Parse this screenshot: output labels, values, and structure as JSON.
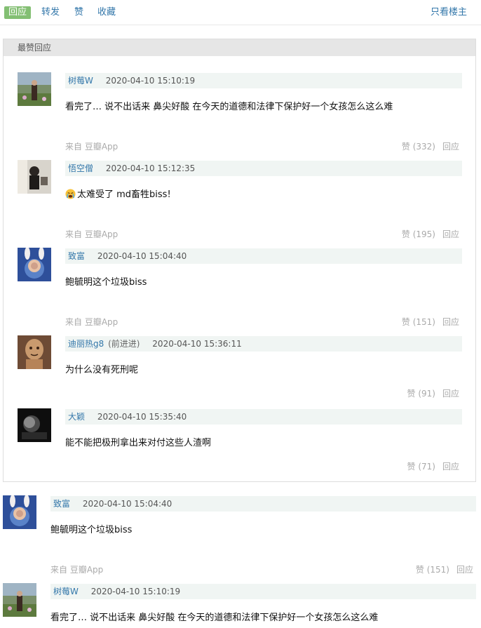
{
  "toolbar": {
    "tabs": [
      {
        "label": "回应",
        "active": true
      },
      {
        "label": "转发",
        "active": false
      },
      {
        "label": "赞",
        "active": false
      },
      {
        "label": "收藏",
        "active": false
      }
    ],
    "right_link": "只看楼主"
  },
  "best": {
    "header": "最赞回应",
    "comments": [
      {
        "user": "树莓W",
        "tag": "",
        "time": "2020-04-10 15:10:19",
        "content": "看完了… 说不出话来 鼻尖好酸 在今天的道德和法律下保护好一个女孩怎么这么难",
        "source": "来自 豆瓣App",
        "likes": "赞 (332)",
        "reply": "回应"
      },
      {
        "user": "悟空僧",
        "tag": "",
        "time": "2020-04-10 15:12:35",
        "content": "太难受了 md畜牲biss!",
        "emoji": "crying-face-icon",
        "source": "来自 豆瓣App",
        "likes": "赞 (195)",
        "reply": "回应"
      },
      {
        "user": "致富",
        "tag": "",
        "time": "2020-04-10 15:04:40",
        "content": "鲍毓明这个垃圾biss",
        "source": "来自 豆瓣App",
        "likes": "赞 (151)",
        "reply": "回应"
      },
      {
        "user": "迪丽热g8",
        "tag": "(前进进)",
        "time": "2020-04-10 15:36:11",
        "content": "为什么没有死刑呢",
        "source": "",
        "likes": "赞 (91)",
        "reply": "回应"
      },
      {
        "user": "大颖",
        "tag": "",
        "time": "2020-04-10 15:35:40",
        "content": "能不能把极刑拿出来对付这些人渣啊",
        "source": "",
        "likes": "赞 (71)",
        "reply": "回应"
      }
    ]
  },
  "all": {
    "comments": [
      {
        "user": "致富",
        "tag": "",
        "time": "2020-04-10 15:04:40",
        "content": "鲍毓明这个垃圾biss",
        "source": "来自 豆瓣App",
        "likes": "赞 (151)",
        "reply": "回应"
      },
      {
        "user": "树莓W",
        "tag": "",
        "time": "2020-04-10 15:10:19",
        "content": "看完了… 说不出话来 鼻尖好酸 在今天的道德和法律下保护好一个女孩怎么这么难",
        "source": "",
        "likes": "",
        "reply": ""
      }
    ]
  }
}
